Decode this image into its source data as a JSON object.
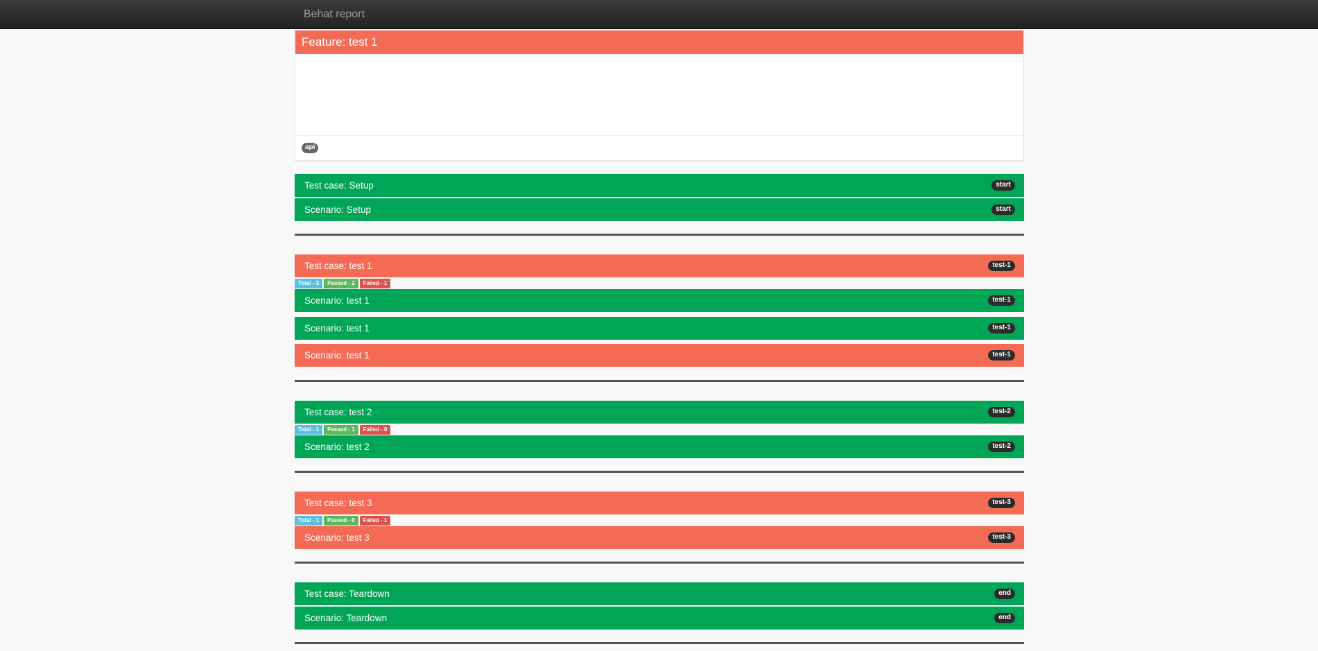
{
  "navbar": {
    "brand": "Behat report"
  },
  "feature": {
    "title": "Feature: test 1",
    "tag": "api"
  },
  "setup": {
    "test_case": {
      "label": "Test case: Setup",
      "badge": "start"
    },
    "scenario": {
      "label": "Scenario: Setup",
      "badge": "start"
    }
  },
  "test1": {
    "test_case": {
      "label": "Test case: test 1",
      "badge": "test-1"
    },
    "counts": {
      "total": "Total - 3",
      "passed": "Passed - 2",
      "failed": "Failed - 1"
    },
    "scenarios": [
      {
        "label": "Scenario: test 1",
        "badge": "test-1"
      },
      {
        "label": "Scenario: test 1",
        "badge": "test-1"
      },
      {
        "label": "Scenario: test 1",
        "badge": "test-1"
      }
    ]
  },
  "test2": {
    "test_case": {
      "label": "Test case: test 2",
      "badge": "test-2"
    },
    "counts": {
      "total": "Total - 1",
      "passed": "Passed - 1",
      "failed": "Failed - 0"
    },
    "scenarios": [
      {
        "label": "Scenario: test 2",
        "badge": "test-2"
      }
    ]
  },
  "test3": {
    "test_case": {
      "label": "Test case: test 3",
      "badge": "test-3"
    },
    "counts": {
      "total": "Total - 1",
      "passed": "Passed - 0",
      "failed": "Failed - 1"
    },
    "scenarios": [
      {
        "label": "Scenario: test 3",
        "badge": "test-3"
      }
    ]
  },
  "teardown": {
    "test_case": {
      "label": "Test case: Teardown",
      "badge": "end"
    },
    "scenario": {
      "label": "Scenario: Teardown",
      "badge": "end"
    }
  },
  "colors": {
    "passed": "#00a556",
    "failed": "#f46a55",
    "total_label": "#5bc0de",
    "passed_label": "#5cb85c",
    "failed_label": "#d9534f"
  }
}
